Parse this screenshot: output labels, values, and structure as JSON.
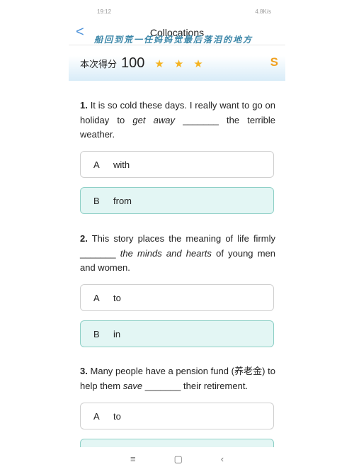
{
  "status": {
    "time": "19:12",
    "speed": "4.8K/s"
  },
  "header": {
    "title": "Collocations",
    "back_icon": "chevron-left-icon"
  },
  "overlay_text": "船回到荒一任妈妈觉最后落泪的地方",
  "score": {
    "label": "本次得分",
    "value": "100",
    "stars": 3,
    "grade": "S",
    "star_color": "#f5b321"
  },
  "questions": [
    {
      "num": "1.",
      "before": " It is so cold these days. I really want to go on holiday to ",
      "em": "get away",
      "after": " _______ the terrible weather.",
      "options": [
        {
          "key": "A",
          "text": "with"
        },
        {
          "key": "B",
          "text": "from",
          "selected": true
        }
      ]
    },
    {
      "num": "2.",
      "before": " This story places the meaning of life firmly _______ ",
      "em": "the minds and hearts",
      "after": " of young men and women.",
      "options": [
        {
          "key": "A",
          "text": "to"
        },
        {
          "key": "B",
          "text": "in",
          "selected": true
        }
      ]
    },
    {
      "num": "3.",
      "before": " Many people have a pension fund (养老金) to help them ",
      "em": "save",
      "after": " _______ their retirement.",
      "options": [
        {
          "key": "A",
          "text": "to"
        }
      ]
    }
  ],
  "navbar": {
    "menu": "≡",
    "home": "▢",
    "back": "‹"
  }
}
